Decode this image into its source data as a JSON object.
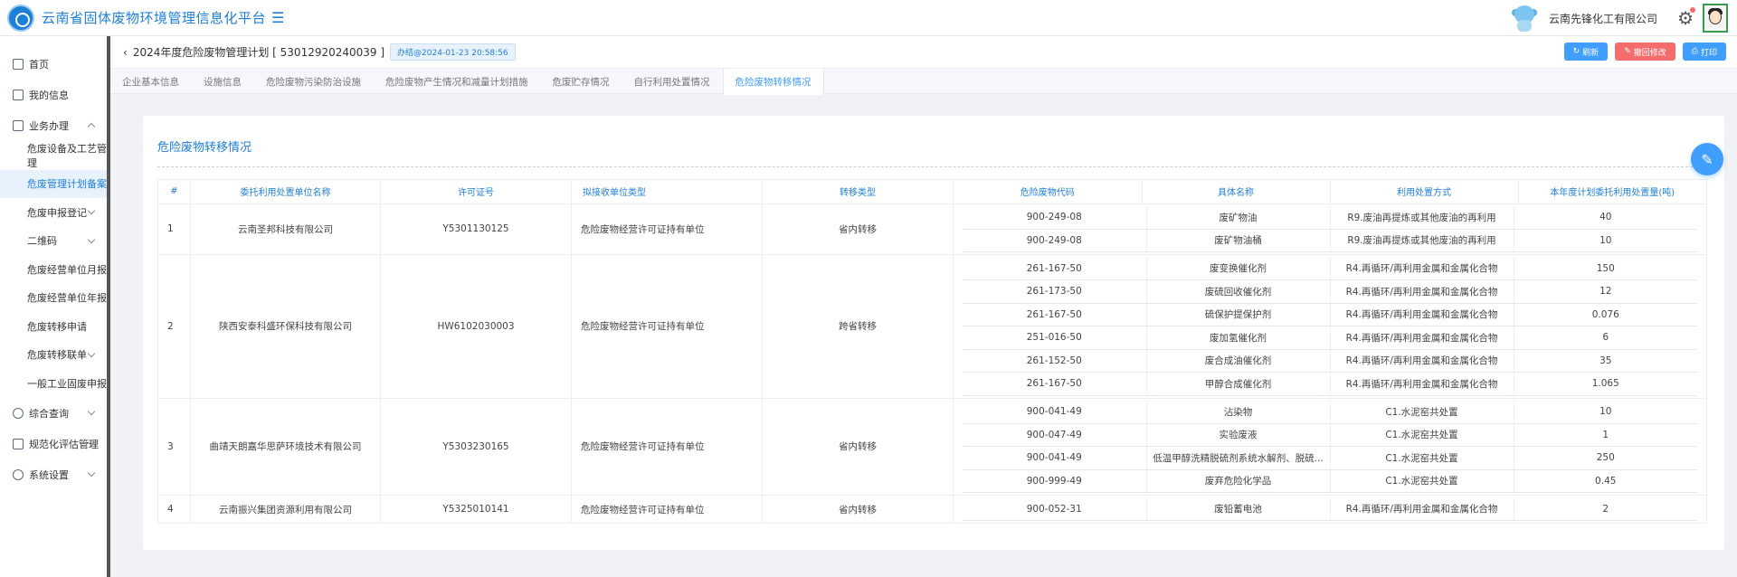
{
  "app": {
    "title": "云南省固体废物环境管理信息化平台",
    "menu_icon": "hamburger-icon"
  },
  "header": {
    "company": "云南先锋化工有限公司"
  },
  "sidebar": {
    "items": [
      {
        "label": "首页",
        "icon": "chart-icon"
      },
      {
        "label": "我的信息",
        "icon": "user-card-icon"
      },
      {
        "label": "业务办理",
        "icon": "document-icon"
      },
      {
        "label": "危废设备及工艺管理"
      },
      {
        "label": "危废管理计划备案"
      },
      {
        "label": "危废申报登记"
      },
      {
        "label": "二维码"
      },
      {
        "label": "危废经营单位月报"
      },
      {
        "label": "危废经营单位年报"
      },
      {
        "label": "危废转移申请"
      },
      {
        "label": "危废转移联单"
      },
      {
        "label": "一般工业固废申报"
      },
      {
        "label": "综合查询",
        "icon": "search-icon"
      },
      {
        "label": "规范化评估管理",
        "icon": "assessment-icon"
      },
      {
        "label": "系统设置",
        "icon": "settings-icon"
      }
    ]
  },
  "topbar": {
    "title": "2024年度危险废物管理计划 [ 53012920240039 ]",
    "status": "办结@2024-01-23 20:58:56",
    "buttons": {
      "refresh": "刷新",
      "withdraw": "撤回修改",
      "print": "打印"
    }
  },
  "tabs": [
    "企业基本信息",
    "设施信息",
    "危险废物污染防治设施",
    "危险废物产生情况和减量计划措施",
    "危废贮存情况",
    "自行利用处置情况",
    "危险废物转移情况"
  ],
  "section_title": "危险废物转移情况",
  "table": {
    "headers": [
      "#",
      "委托利用处置单位名称",
      "许可证号",
      "拟接收单位类型",
      "转移类型",
      "危险废物代码",
      "具体名称",
      "利用处置方式",
      "本年度计划委托利用处置量(吨)"
    ],
    "rows": [
      {
        "no": "1",
        "unit": "云南圣邦科技有限公司",
        "license": "Y5301130125",
        "unit_type": "危险废物经营许可证持有单位",
        "transfer": "省内转移",
        "wastes": [
          {
            "code": "900-249-08",
            "name": "废矿物油",
            "method": "R9.废油再提炼或其他废油的再利用",
            "qty": "40"
          },
          {
            "code": "900-249-08",
            "name": "废矿物油桶",
            "method": "R9.废油再提炼或其他废油的再利用",
            "qty": "10"
          }
        ]
      },
      {
        "no": "2",
        "unit": "陕西安泰科盛环保科技有限公司",
        "license": "HW6102030003",
        "unit_type": "危险废物经营许可证持有单位",
        "transfer": "跨省转移",
        "wastes": [
          {
            "code": "261-167-50",
            "name": "废变换催化剂",
            "method": "R4.再循环/再利用金属和金属化合物",
            "qty": "150"
          },
          {
            "code": "261-173-50",
            "name": "废硫回收催化剂",
            "method": "R4.再循环/再利用金属和金属化合物",
            "qty": "12"
          },
          {
            "code": "261-167-50",
            "name": "硫保护提保护剂",
            "method": "R4.再循环/再利用金属和金属化合物",
            "qty": "0.076"
          },
          {
            "code": "251-016-50",
            "name": "废加氢催化剂",
            "method": "R4.再循环/再利用金属和金属化合物",
            "qty": "6"
          },
          {
            "code": "261-152-50",
            "name": "废合成油催化剂",
            "method": "R4.再循环/再利用金属和金属化合物",
            "qty": "35"
          },
          {
            "code": "261-167-50",
            "name": "甲醇合成催化剂",
            "method": "R4.再循环/再利用金属和金属化合物",
            "qty": "1.065"
          }
        ]
      },
      {
        "no": "3",
        "unit": "曲靖天朗嘉华思萨环境技术有限公司",
        "license": "Y5303230165",
        "unit_type": "危险废物经营许可证持有单位",
        "transfer": "省内转移",
        "wastes": [
          {
            "code": "900-041-49",
            "name": "沾染物",
            "method": "C1.水泥窑共处置",
            "qty": "10"
          },
          {
            "code": "900-047-49",
            "name": "实验废液",
            "method": "C1.水泥窑共处置",
            "qty": "1"
          },
          {
            "code": "900-041-49",
            "name": "低温甲醇洗精脱硫剂系统水解剂、脱硫...",
            "method": "C1.水泥窑共处置",
            "qty": "250"
          },
          {
            "code": "900-999-49",
            "name": "废弃危险化学品",
            "method": "C1.水泥窑共处置",
            "qty": "0.45"
          }
        ]
      },
      {
        "no": "4",
        "unit": "云南振兴集团资源利用有限公司",
        "license": "Y5325010141",
        "unit_type": "危险废物经营许可证持有单位",
        "transfer": "省内转移",
        "wastes": [
          {
            "code": "900-052-31",
            "name": "废铅蓄电池",
            "method": "R4.再循环/再利用金属和金属化合物",
            "qty": "2"
          }
        ]
      }
    ]
  }
}
